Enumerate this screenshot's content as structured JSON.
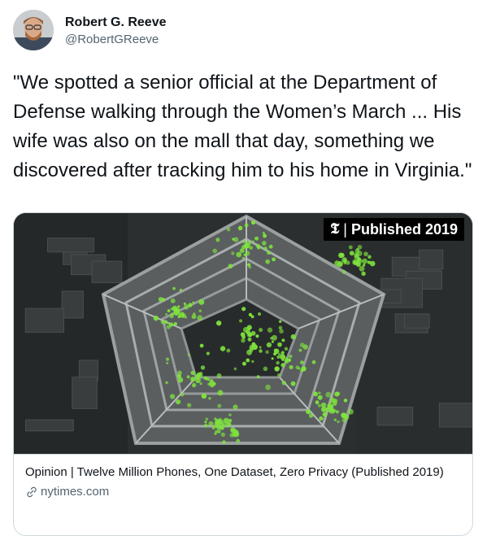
{
  "author": {
    "display_name": "Robert G. Reeve",
    "handle": "@RobertGReeve",
    "avatar_icon": "user-avatar"
  },
  "tweet": {
    "text": "\"We spotted a senior official at the Department of Defense walking through the Women’s March ... His wife was also on the mall that day, something we discovered after tracking him to his home in Virginia.\""
  },
  "card": {
    "badge": {
      "logo": "𝕿",
      "text": "Published 2019"
    },
    "title": "Opinion | Twelve Million Phones, One Dataset, Zero Privacy (Published 2019)",
    "domain": "nytimes.com",
    "domain_icon": "link-icon",
    "image_icon": "pentagon-aerial-image"
  },
  "colors": {
    "text": "#0f1419",
    "secondary": "#536471",
    "border": "#cfd9de",
    "dot_green": "#7ee23d"
  }
}
